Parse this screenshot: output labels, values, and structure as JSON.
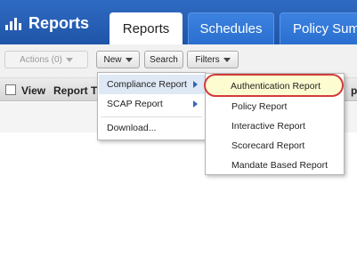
{
  "app": {
    "brand": "Reports",
    "brand_icon": "bar-chart-icon"
  },
  "tabs": [
    {
      "label": "Reports",
      "active": true
    },
    {
      "label": "Schedules",
      "active": false
    },
    {
      "label": "Policy Summ",
      "active": false
    }
  ],
  "toolbar": {
    "actions_label": "Actions (0)",
    "new_label": "New",
    "search_label": "Search",
    "filters_label": "Filters"
  },
  "table": {
    "columns": [
      "View",
      "Report Ti",
      "p"
    ]
  },
  "menu": {
    "items": [
      {
        "label": "Compliance Report",
        "has_submenu": true,
        "hovered": true
      },
      {
        "label": "SCAP Report",
        "has_submenu": true
      },
      {
        "label": "Download..."
      }
    ]
  },
  "submenu": {
    "items": [
      {
        "label": "Authentication Report",
        "highlighted": true
      },
      {
        "label": "Policy Report"
      },
      {
        "label": "Interactive Report"
      },
      {
        "label": "Scorecard Report"
      },
      {
        "label": "Mandate Based Report"
      }
    ]
  },
  "colors": {
    "header_blue": "#1f55a8",
    "tab_blue": "#2a6fcf",
    "highlight_ring": "#d23b3b",
    "highlight_fill": "#fdfbd0"
  }
}
